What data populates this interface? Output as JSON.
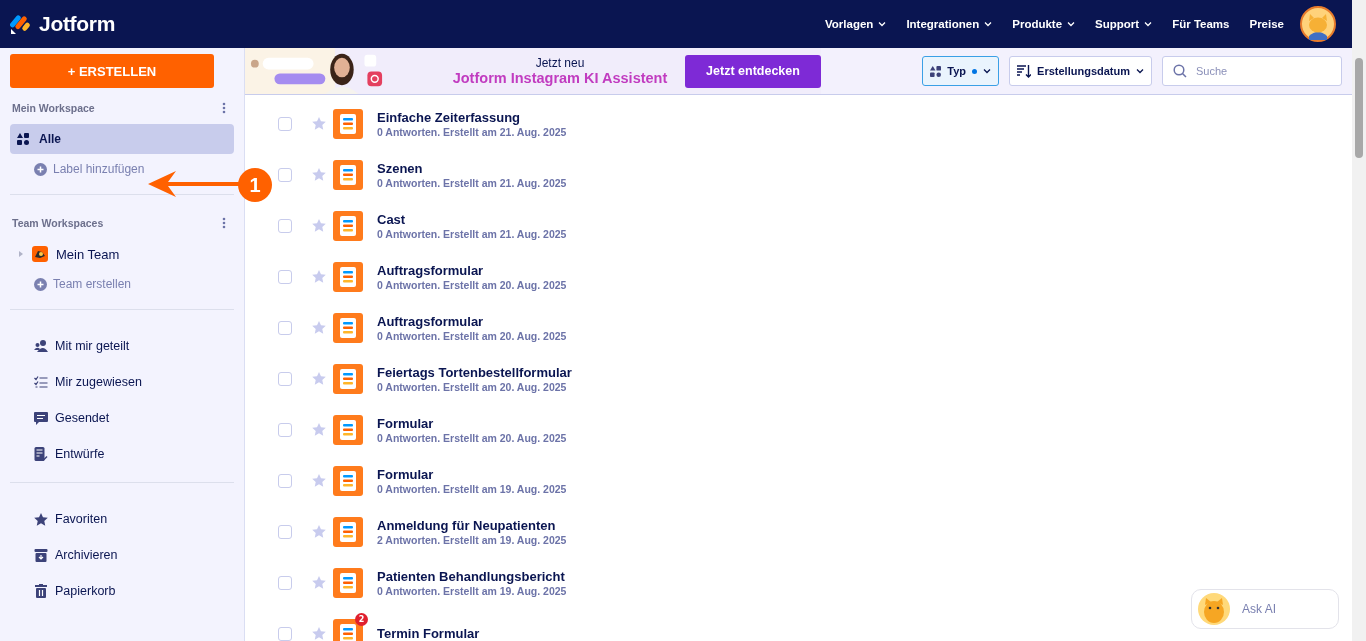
{
  "header": {
    "logo": "Jotform",
    "nav": [
      {
        "label": "Vorlagen",
        "dropdown": true
      },
      {
        "label": "Integrationen",
        "dropdown": true
      },
      {
        "label": "Produkte",
        "dropdown": true
      },
      {
        "label": "Support",
        "dropdown": true
      },
      {
        "label": "Für Teams",
        "dropdown": false
      },
      {
        "label": "Preise",
        "dropdown": false
      }
    ]
  },
  "sidebar": {
    "create_button": "+ ERSTELLEN",
    "my_workspace": {
      "title": "Mein Workspace",
      "items": [
        {
          "label": "Alle",
          "selected": true
        }
      ],
      "add_label": "Label hinzufügen"
    },
    "team_workspaces": {
      "title": "Team Workspaces",
      "teams": [
        {
          "label": "Mein Team",
          "expanded": false
        }
      ],
      "create_team": "Team erstellen"
    },
    "shared_items": [
      {
        "kind": "shared",
        "label": "Mit mir geteilt"
      },
      {
        "kind": "assigned",
        "label": "Mir zugewiesen"
      },
      {
        "kind": "sent",
        "label": "Gesendet"
      },
      {
        "kind": "drafts",
        "label": "Entwürfe"
      }
    ],
    "other_items": [
      {
        "kind": "favorites",
        "label": "Favoriten"
      },
      {
        "kind": "archive",
        "label": "Archivieren"
      },
      {
        "kind": "trash",
        "label": "Papierkorb"
      }
    ]
  },
  "banner": {
    "kind": "picture",
    "eyebrow": "Jetzt neu",
    "headline": "Jotform Instagram KI Assistent",
    "button": "Jetzt entdecken"
  },
  "toolbar": {
    "type_filter": "Typ",
    "type_filter_active": true,
    "sort": "Erstellungsdatum",
    "search": {
      "placeholder": "Suche"
    }
  },
  "forms": [
    {
      "title": "Einfache Zeiterfassung",
      "meta": "0 Antworten. Erstellt am 21. Aug. 2025",
      "checked": false,
      "starred": false
    },
    {
      "title": "Szenen",
      "meta": "0 Antworten. Erstellt am 21. Aug. 2025",
      "checked": false,
      "starred": false
    },
    {
      "title": "Cast",
      "meta": "0 Antworten. Erstellt am 21. Aug. 2025",
      "checked": false,
      "starred": false
    },
    {
      "title": "Auftragsformular",
      "meta": "0 Antworten. Erstellt am 20. Aug. 2025",
      "checked": false,
      "starred": false
    },
    {
      "title": "Auftragsformular",
      "meta": "0 Antworten. Erstellt am 20. Aug. 2025",
      "checked": false,
      "starred": false
    },
    {
      "title": "Feiertags Tortenbestellformular",
      "meta": "0 Antworten. Erstellt am 20. Aug. 2025",
      "checked": false,
      "starred": false
    },
    {
      "title": "Formular",
      "meta": "0 Antworten. Erstellt am 20. Aug. 2025",
      "checked": false,
      "starred": false
    },
    {
      "title": "Formular",
      "meta": "0 Antworten. Erstellt am 19. Aug. 2025",
      "checked": false,
      "starred": false
    },
    {
      "title": "Anmeldung für Neupatienten",
      "meta": "2 Antworten. Erstellt am 19. Aug. 2025",
      "checked": false,
      "starred": false
    },
    {
      "title": "Patienten Behandlungsbericht",
      "meta": "0 Antworten. Erstellt am 19. Aug. 2025",
      "checked": false,
      "starred": false
    },
    {
      "title": "Termin Formular",
      "badge": "2",
      "checked": false,
      "starred": false
    }
  ],
  "annotation": {
    "number": "1"
  },
  "ask_ai": {
    "label": "Ask AI"
  }
}
